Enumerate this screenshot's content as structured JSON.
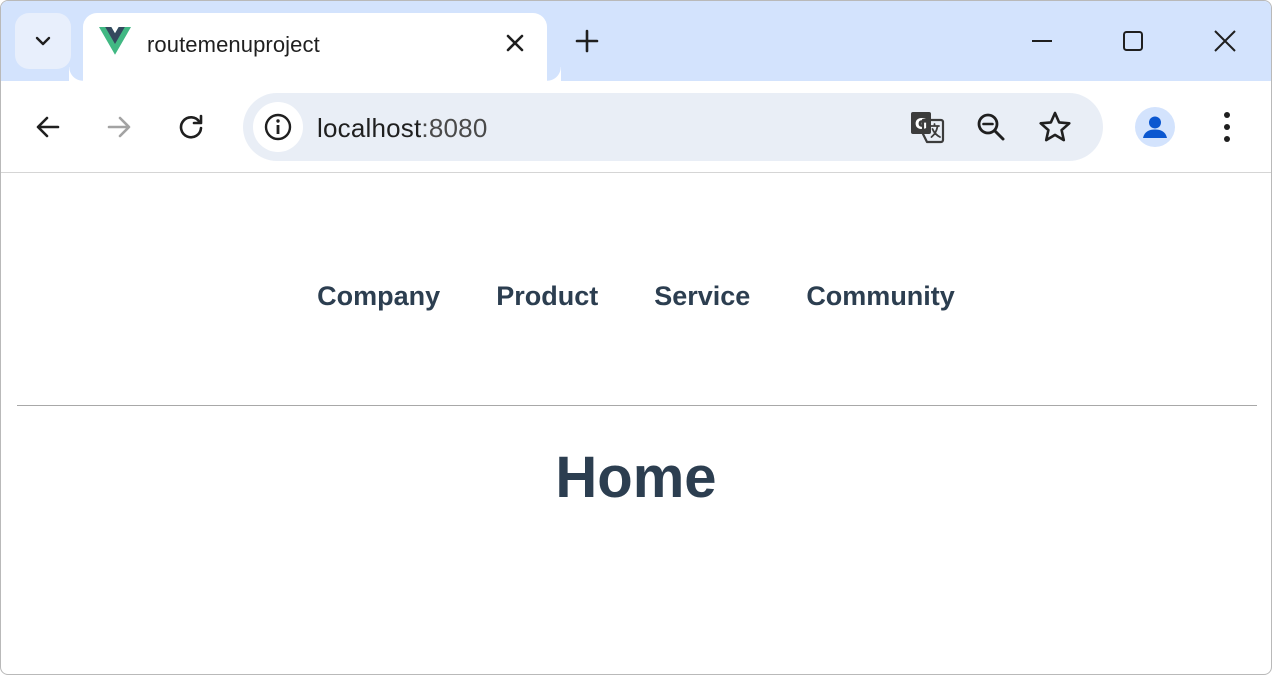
{
  "browser": {
    "tab": {
      "title": "routemenuproject",
      "favicon": "vue-logo-icon"
    },
    "address_bar": {
      "host": "localhost",
      "port": ":8080"
    },
    "colors": {
      "tabstrip": "#d3e3fd",
      "omnibox": "#e9eef6",
      "avatar": "#0b57d0"
    }
  },
  "page": {
    "nav": [
      {
        "label": "Company"
      },
      {
        "label": "Product"
      },
      {
        "label": "Service"
      },
      {
        "label": "Community"
      }
    ],
    "heading": "Home",
    "colors": {
      "text": "#2c3e50"
    }
  }
}
